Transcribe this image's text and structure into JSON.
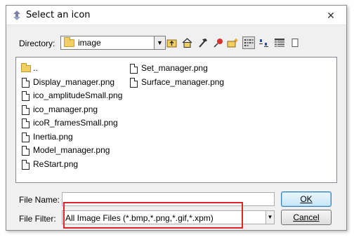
{
  "window": {
    "title": "Select an icon",
    "close_glyph": "✕"
  },
  "directory": {
    "label": "Directory:",
    "value": "image"
  },
  "toolbar": {
    "icons": [
      "up-folder-icon",
      "home-icon",
      "hammer-icon",
      "pin-icon",
      "new-folder-icon",
      "list-view-icon",
      "small-icons-view-icon",
      "details-view-icon",
      "copy-icon"
    ]
  },
  "files": {
    "parent": "..",
    "column1": [
      "Display_manager.png",
      "ico_amplitudeSmall.png",
      "ico_manager.png",
      "icoR_framesSmall.png",
      "Inertia.png",
      "Model_manager.png",
      "ReStart.png"
    ],
    "column2": [
      "Set_manager.png",
      "Surface_manager.png"
    ]
  },
  "file_name": {
    "label": "File Name:",
    "value": ""
  },
  "file_filter": {
    "label": "File Filter:",
    "value": "All Image Files (*.bmp,*.png,*.gif,*.xpm)"
  },
  "buttons": {
    "ok": "OK",
    "cancel": "Cancel"
  },
  "colors": {
    "highlight": "#e0242a",
    "folder": "#f2cf63"
  }
}
